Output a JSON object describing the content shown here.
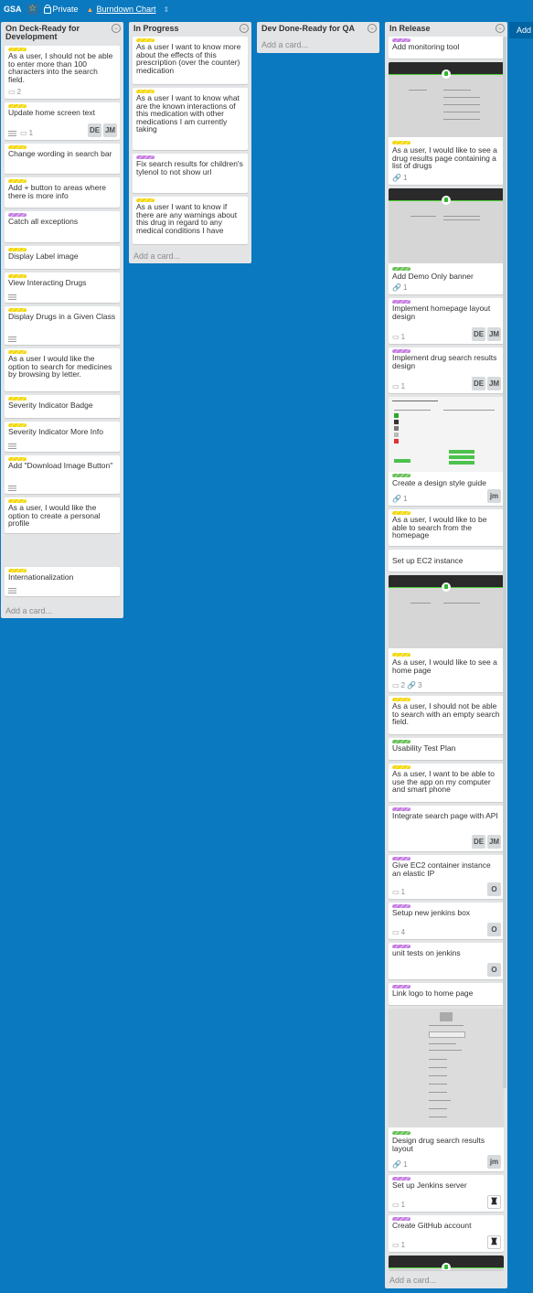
{
  "board": {
    "name": "GSA",
    "visibility": "Private",
    "burndown_label": "Burndown Chart",
    "add_list_label": "Add"
  },
  "lists": [
    {
      "title": "On Deck-Ready for Development",
      "add_card": "Add a card...",
      "cards": [
        {
          "labels": [
            "yellow"
          ],
          "text": "As a user, I should not be able to enter more than 100 characters into the search field.",
          "comments": "2"
        },
        {
          "labels": [
            "yellow"
          ],
          "text": "Update home screen text",
          "desc": true,
          "comments": "1",
          "members": [
            "DE",
            "JM"
          ]
        },
        {
          "labels": [
            "yellow"
          ],
          "text": "Change wording in search bar"
        },
        {
          "labels": [
            "yellow"
          ],
          "text": "Add + button to areas where there is more info"
        },
        {
          "labels": [
            "purple"
          ],
          "text": "Catch all exceptions"
        },
        {
          "labels": [
            "yellow"
          ],
          "text": "Display Label image"
        },
        {
          "labels": [
            "yellow"
          ],
          "text": "View Interacting Drugs",
          "desc": true
        },
        {
          "labels": [
            "yellow"
          ],
          "text": "Display Drugs in a Given Class",
          "desc": true
        },
        {
          "labels": [
            "yellow"
          ],
          "text": "As a user I would like the option to search for medicines by browsing by letter."
        },
        {
          "labels": [
            "yellow"
          ],
          "text": "Severity Indicator Badge"
        },
        {
          "labels": [
            "yellow"
          ],
          "text": "Severity Indicator More Info",
          "desc": true
        },
        {
          "labels": [
            "yellow"
          ],
          "text": "Add \"Download Image Button\"",
          "desc": true
        },
        {
          "labels": [
            "yellow"
          ],
          "text": "As a user, I would like the option to create a personal profile"
        },
        {
          "labels": [
            "yellow"
          ],
          "text": "Internationalization",
          "desc": true
        }
      ]
    },
    {
      "title": "In Progress",
      "add_card": "Add a card...",
      "cards": [
        {
          "labels": [
            "yellow"
          ],
          "text": "As a user I want to know more about the effects of this prescription (over the counter) medication"
        },
        {
          "labels": [
            "yellow"
          ],
          "text": "As a user I want to know what are the known interactions of this medication with other medications I am currently taking"
        },
        {
          "labels": [
            "purple"
          ],
          "text": "Fix search results for children's tylenol to not show url"
        },
        {
          "labels": [
            "yellow"
          ],
          "text": "As a user I want to know if there are any warnings about this drug in regard to any medical conditions I have"
        }
      ]
    },
    {
      "title": "Dev Done-Ready for QA",
      "add_card": "Add a card..."
    },
    {
      "title": "In Release",
      "add_card": "Add a card...",
      "cards": [
        {
          "labels": [
            "purple"
          ],
          "text": "Add monitoring tool"
        },
        {
          "labels": [
            "yellow"
          ],
          "text": "As a user, I would like to see a drug results page containing a list of drugs",
          "attachments": "1",
          "cover": "FIND A MEDICATION"
        },
        {
          "labels": [
            "green"
          ],
          "text": "Add Demo Only banner",
          "attachments": "1",
          "cover": "FIND A MEDICATION"
        },
        {
          "labels": [
            "purple"
          ],
          "text": "Implement homepage layout design",
          "comments": "1",
          "members": [
            "DE",
            "JM"
          ]
        },
        {
          "labels": [
            "purple"
          ],
          "text": "Implement drug search results design",
          "comments": "1",
          "members": [
            "DE",
            "JM"
          ]
        },
        {
          "labels": [
            "green"
          ],
          "text": "Create a design style guide",
          "attachments": "1",
          "members": [
            "jm"
          ],
          "cover": "PROTOTYPE DESIGN STYLE GUIDE"
        },
        {
          "labels": [
            "yellow"
          ],
          "text": "As a user, I would like to be able to search from the homepage"
        },
        {
          "labels": [],
          "text": "Set up EC2 instance"
        },
        {
          "labels": [
            "yellow"
          ],
          "text": "As a user, I would like to see a home page",
          "comments": "2",
          "attachments": "3",
          "cover": "FIND A MEDICATION"
        },
        {
          "labels": [
            "yellow"
          ],
          "text": "As a user, I should not be able to search with an empty search field."
        },
        {
          "labels": [
            "green"
          ],
          "text": "Usability Test Plan"
        },
        {
          "labels": [
            "yellow"
          ],
          "text": "As a user, I want to be able to use the app on my computer and smart phone"
        },
        {
          "labels": [
            "purple"
          ],
          "text": "Integrate search page with API",
          "members": [
            "DE",
            "JM"
          ]
        },
        {
          "labels": [
            "purple"
          ],
          "text": "Give EC2 container instance an elastic IP",
          "comments": "1",
          "members": [
            "O"
          ]
        },
        {
          "labels": [
            "purple"
          ],
          "text": "Setup new jenkins box",
          "comments": "4",
          "members": [
            "O"
          ]
        },
        {
          "labels": [
            "purple"
          ],
          "text": "unit tests on jenkins",
          "members": [
            "O"
          ]
        },
        {
          "labels": [
            "purple"
          ],
          "text": "Link logo to home page"
        },
        {
          "labels": [
            "green"
          ],
          "text": "Design drug search results layout",
          "attachments": "1",
          "members": [
            "jm"
          ],
          "cover": "FIND A MEDICATION"
        },
        {
          "labels": [
            "purple"
          ],
          "text": "Set up Jenkins server",
          "comments": "1",
          "members": [
            "avatar"
          ]
        },
        {
          "labels": [
            "purple"
          ],
          "text": "Create GitHub account",
          "comments": "1",
          "members": [
            "avatar"
          ]
        }
      ]
    }
  ]
}
